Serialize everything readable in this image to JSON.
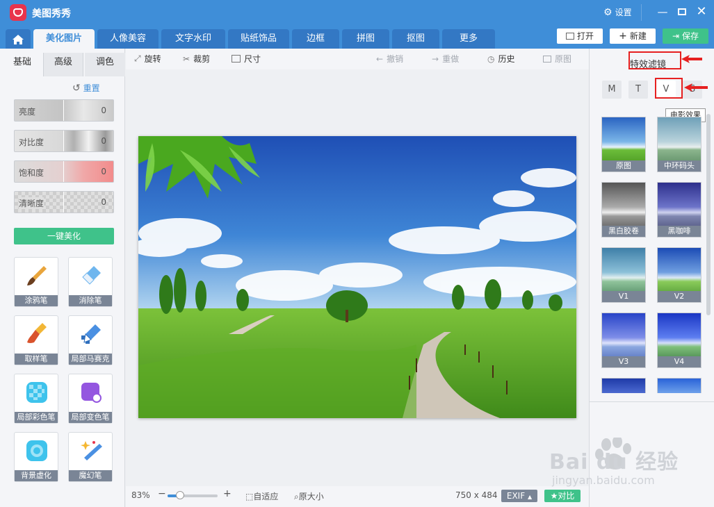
{
  "app": {
    "title": "美图秀秀"
  },
  "titlebar": {
    "settings_label": "设置"
  },
  "tabs": [
    {
      "label": "美化图片",
      "active": true
    },
    {
      "label": "人像美容"
    },
    {
      "label": "文字水印"
    },
    {
      "label": "贴纸饰品"
    },
    {
      "label": "边框"
    },
    {
      "label": "拼图"
    },
    {
      "label": "抠图"
    },
    {
      "label": "更多"
    }
  ],
  "header_buttons": {
    "open": "打开",
    "new": "新建",
    "save": "保存"
  },
  "left_panel": {
    "subtabs": [
      "基础",
      "高级",
      "调色"
    ],
    "reset_label": "重置",
    "sliders": [
      {
        "label": "亮度",
        "value": "0"
      },
      {
        "label": "对比度",
        "value": "0"
      },
      {
        "label": "饱和度",
        "value": "0"
      },
      {
        "label": "清晰度",
        "value": "0"
      }
    ],
    "auto_button": "一键美化",
    "tools": [
      "涂鸦笔",
      "消除笔",
      "取样笔",
      "局部马赛克",
      "局部彩色笔",
      "局部变色笔",
      "背景虚化",
      "魔幻笔"
    ]
  },
  "toolbar": {
    "rotate": "旋转",
    "crop": "裁剪",
    "size": "尺寸",
    "undo": "撤销",
    "redo": "重做",
    "history": "历史",
    "original": "原图"
  },
  "bottom_bar": {
    "zoom": "83%",
    "fit": "自适应",
    "actual": "原大小",
    "dimensions": "750 x 484",
    "exif": "EXIF",
    "compare": "对比"
  },
  "right_panel": {
    "title": "特效滤镜",
    "letter_tabs": [
      "M",
      "T",
      "V",
      "S"
    ],
    "tooltip": "电影效果",
    "filters": [
      "原图",
      "中环码头",
      "黑白胶卷",
      "黑咖啡",
      "V1",
      "V2",
      "V3",
      "V4"
    ]
  },
  "watermark": {
    "text": "Bai du 经验",
    "sub": "jingyan.baidu.com"
  },
  "colors": {
    "brand_blue": "#3f8ed8",
    "save_green": "#3fc28a",
    "highlight_red": "#e62020"
  }
}
